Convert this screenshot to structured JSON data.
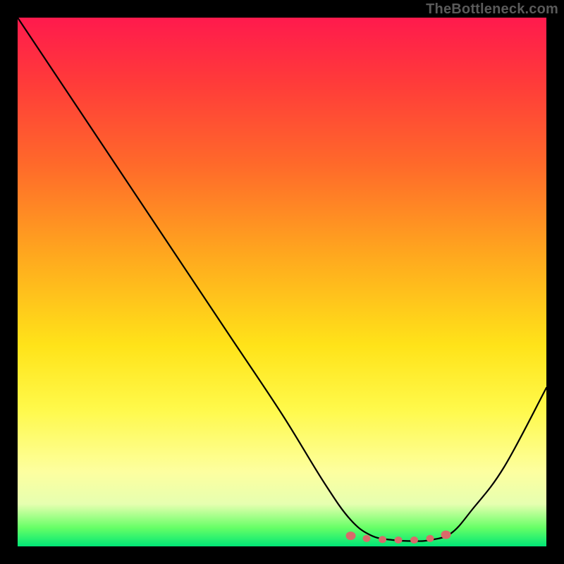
{
  "watermark": "TheBottleneck.com",
  "chart_data": {
    "type": "line",
    "title": "",
    "xlabel": "",
    "ylabel": "",
    "xlim": [
      0,
      100
    ],
    "ylim": [
      0,
      100
    ],
    "grid": false,
    "legend": false,
    "series": [
      {
        "name": "bottleneck-curve",
        "x": [
          0,
          10,
          20,
          30,
          40,
          50,
          58,
          63,
          67,
          71,
          75,
          78,
          82,
          86,
          92,
          100
        ],
        "y": [
          100,
          85,
          70,
          55,
          40,
          25,
          12,
          5,
          2,
          1.2,
          1.0,
          1.2,
          2.5,
          7,
          15,
          30
        ]
      }
    ],
    "highlight_points": {
      "name": "minimum-markers",
      "x": [
        63,
        66,
        69,
        72,
        75,
        78,
        81
      ],
      "y": [
        2.0,
        1.5,
        1.3,
        1.2,
        1.2,
        1.5,
        2.2
      ]
    }
  },
  "colors": {
    "curve": "#000000",
    "dots": "#d96a6a",
    "gradient_top": "#ff1a4d",
    "gradient_bottom": "#00e676",
    "frame": "#000000"
  }
}
